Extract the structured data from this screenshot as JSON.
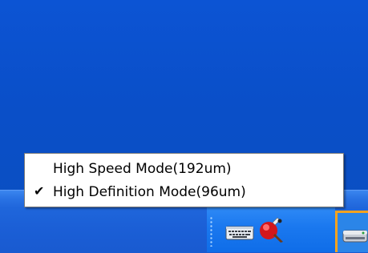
{
  "context_menu": {
    "items": [
      {
        "label": "High Speed Mode(192um)",
        "checked": false,
        "check_mark": ""
      },
      {
        "label": "High Definition Mode(96um)",
        "checked": true,
        "check_mark": "✔"
      }
    ]
  },
  "taskbar": {
    "tray_icons": [
      "keyboard-icon",
      "paint-icon",
      "scanner-app-icon"
    ]
  },
  "colors": {
    "desktop": "#0b51c8",
    "taskbar": "#1f66db",
    "tray": "#1a78ef",
    "highlight_frame": "#f6a31f",
    "menu_background": "#ffffff"
  }
}
